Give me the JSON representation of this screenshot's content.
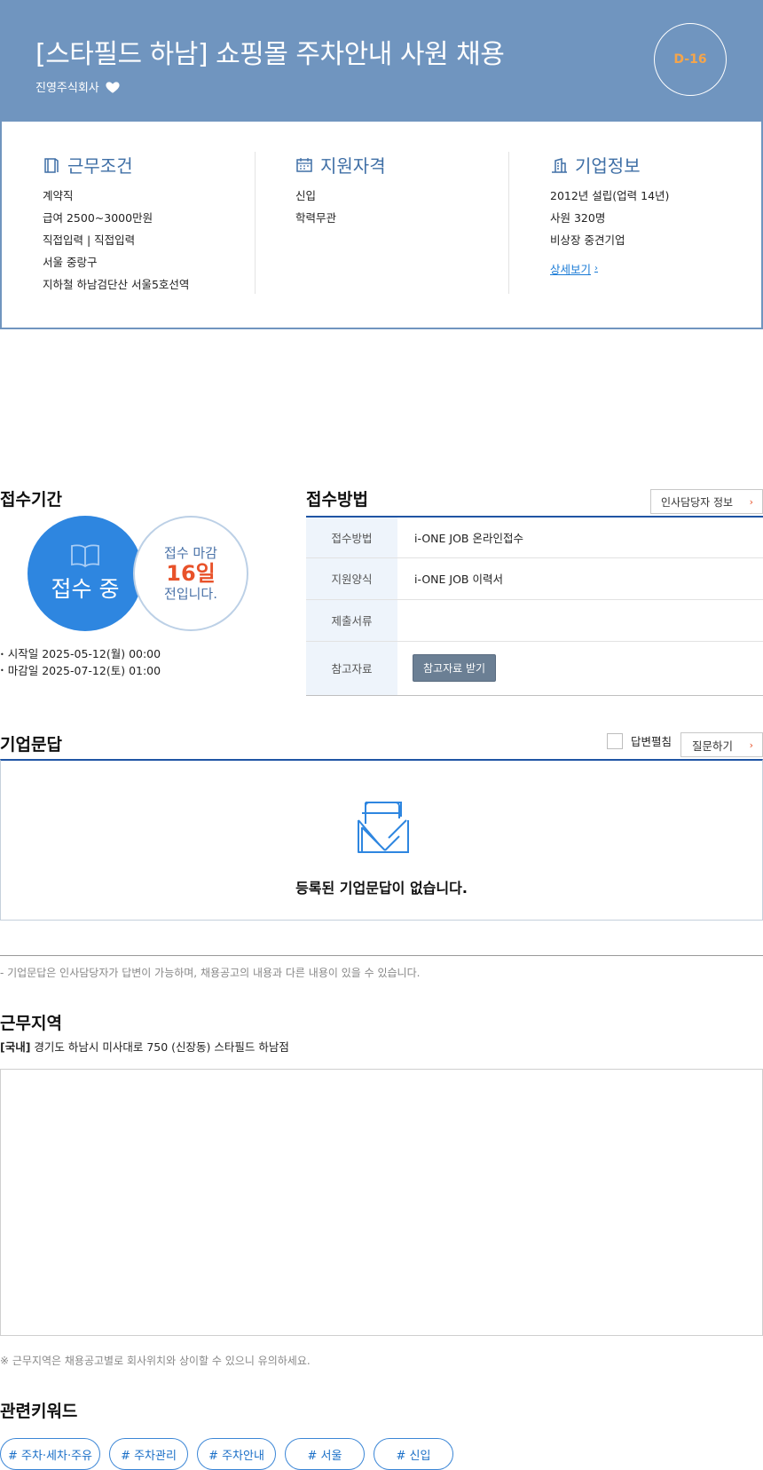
{
  "header": {
    "title": "[스타필드 하남] 쇼핑몰 주차안내 사원 채용",
    "company": "진영주식회사",
    "dday": "D-16",
    "colors": {
      "banner": "#7095bf",
      "dday": "#f6a54a"
    }
  },
  "info": {
    "work": {
      "title": "근무조건",
      "icon": "book-icon",
      "lines": [
        "계약직",
        "급여 2500~3000만원",
        "직접입력 | 직접입력",
        "서울 중랑구",
        "지하철 하남검단산 서울5호선역"
      ]
    },
    "qualification": {
      "title": "지원자격",
      "icon": "calendar-icon",
      "lines": [
        "신입",
        "학력무관"
      ]
    },
    "company": {
      "title": "기업정보",
      "icon": "building-icon",
      "lines": [
        "2012년 설립(업력 14년)",
        "사원 320명",
        "비상장 중견기업"
      ],
      "detail_link": "상세보기"
    }
  },
  "period": {
    "title": "접수기간",
    "status": "접수 중",
    "deadline_label": "접수 마감",
    "deadline_days": "16일",
    "deadline_suffix": "전입니다.",
    "start": "시작일 2025-05-12(월) 00:00",
    "end": "마감일 2025-07-12(토) 01:00"
  },
  "method": {
    "title": "접수방법",
    "hr_button": "인사담당자 정보",
    "rows": [
      {
        "key": "접수방법",
        "value": "i-ONE JOB 온라인접수"
      },
      {
        "key": "지원양식",
        "value": "i-ONE JOB 이력서"
      },
      {
        "key": "제출서류",
        "value": ""
      },
      {
        "key": "참고자료",
        "value": "참고자료 받기"
      }
    ]
  },
  "qa": {
    "title": "기업문답",
    "expand_label": "답변펼침",
    "ask_button": "질문하기",
    "empty_text": "등록된 기업문답이 없습니다.",
    "note": "- 기업문답은 인사담당자가 답변이 가능하며, 채용공고의 내용과 다른 내용이 있을 수 있습니다."
  },
  "location": {
    "title": "근무지역",
    "region": "[국내]",
    "address": " 경기도 하남시 미사대로 750 (신장동) 스타필드 하남점",
    "note": "※ 근무지역은 채용공고별로 회사위치와 상이할 수 있으니 유의하세요."
  },
  "keywords": {
    "title": "관련키워드",
    "items": [
      "# 주차·세차·주유",
      "# 주차관리",
      "# 주차안내",
      "# 서울",
      "# 신입"
    ]
  }
}
